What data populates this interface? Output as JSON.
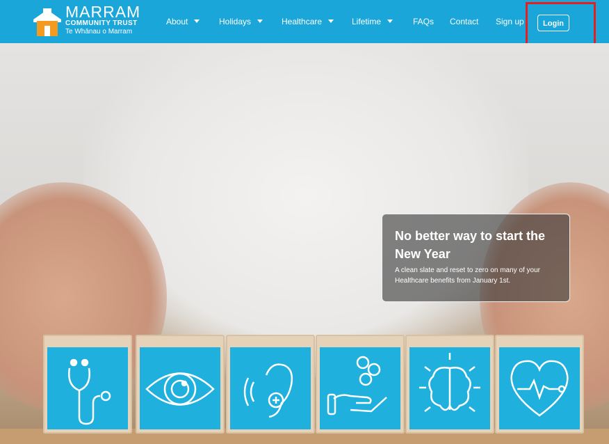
{
  "brand": {
    "title": "MARRAM",
    "subtitle": "COMMUNITY TRUST",
    "maori": "Te Whānau o Marram",
    "color": "#1aa6d9"
  },
  "nav": {
    "items": [
      {
        "label": "About",
        "dropdown": true
      },
      {
        "label": "Holidays",
        "dropdown": true
      },
      {
        "label": "Healthcare",
        "dropdown": true
      },
      {
        "label": "Lifetime",
        "dropdown": true
      },
      {
        "label": "FAQs",
        "dropdown": false
      },
      {
        "label": "Contact",
        "dropdown": false
      },
      {
        "label": "Sign up",
        "dropdown": false
      }
    ],
    "login": "Login"
  },
  "hero": {
    "heading": "No better way to start the New Year",
    "text": "A clean slate and reset to zero on many of your Healthcare benefits from January 1st."
  },
  "blocks": [
    {
      "icon": "stethoscope-icon"
    },
    {
      "icon": "eye-icon"
    },
    {
      "icon": "ear-hearing-icon"
    },
    {
      "icon": "hand-coins-icon"
    },
    {
      "icon": "brain-icon"
    },
    {
      "icon": "heart-pulse-icon"
    }
  ],
  "colors": {
    "highlight": "#e81e1e",
    "block_blue": "#1fb0dd"
  }
}
